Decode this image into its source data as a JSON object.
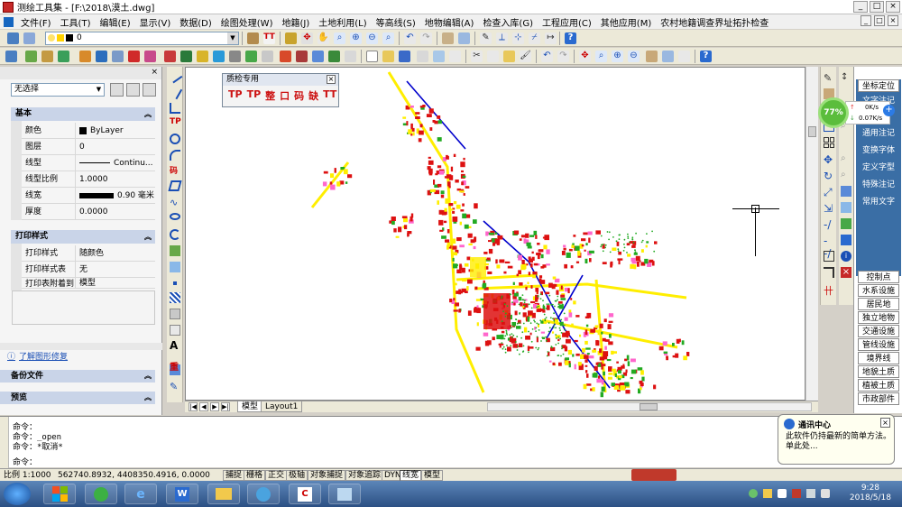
{
  "window": {
    "title": "测绘工具集 - [F:\\2018\\漠土.dwg]",
    "buttons": [
      "_",
      "□",
      "×"
    ]
  },
  "menu": {
    "items": [
      "文件(F)",
      "工具(T)",
      "编辑(E)",
      "显示(V)",
      "数据(D)",
      "绘图处理(W)",
      "地籍(J)",
      "土地利用(L)",
      "等高线(S)",
      "地物编辑(A)",
      "检查入库(G)",
      "工程应用(C)",
      "其他应用(M)",
      "农村地籍调查界址拓扑检查"
    ],
    "mdi_buttons": [
      "_",
      "□",
      "×"
    ]
  },
  "toolbar": {
    "layer_value": "0"
  },
  "properties": {
    "selection": "无选择",
    "basic_title": "基本",
    "basic": [
      {
        "key": "颜色",
        "value": "ByLayer"
      },
      {
        "key": "图层",
        "value": "0"
      },
      {
        "key": "线型",
        "value": "Continu..."
      },
      {
        "key": "线型比例",
        "value": "1.0000"
      },
      {
        "key": "线宽",
        "value": "0.90 毫米"
      },
      {
        "key": "厚度",
        "value": "0.0000"
      }
    ],
    "print_title": "打印样式",
    "print": [
      {
        "key": "打印样式",
        "value": "随颜色"
      },
      {
        "key": "打印样式表",
        "value": "无"
      },
      {
        "key": "打印表附着到",
        "value": "模型"
      }
    ]
  },
  "lower_panel": {
    "link": "了解图形修复",
    "backup": "备份文件",
    "preview": "预览"
  },
  "float_toolbar": {
    "title": "质检专用",
    "icons": [
      "TP",
      "TP",
      "整",
      "口",
      "码",
      "缺",
      "TT"
    ]
  },
  "right_panel": {
    "top_buttons": [
      "坐标定位",
      "文字注记",
      "通用注记",
      "变换字体",
      "定义字型",
      "特殊注记",
      "常用文字"
    ],
    "bottom_buttons": [
      "控制点",
      "水系设施",
      "居民地",
      "独立地物",
      "交通设施",
      "管线设施",
      "境界线",
      "地貌土质",
      "植被土质",
      "市政部件"
    ]
  },
  "speed_widget": {
    "percent": "77%",
    "up": "0K/s",
    "down": "0.07K/s"
  },
  "layout_tabs": [
    "模型",
    "Layout1"
  ],
  "command": {
    "lines": [
      "命令：",
      "命令：_open",
      "命令：*取消*",
      "命令："
    ]
  },
  "balloon": {
    "title": "通讯中心",
    "text": "此软件仍持最新的简单方法。单此处..."
  },
  "status": {
    "scale": "比例 1:1000",
    "coords": "562740.8932, 4408350.4916, 0.0000",
    "toggles": [
      "捕捉",
      "栅格",
      "正交",
      "极轴",
      "对象捕捉",
      "对象追踪",
      "DYN",
      "线宽",
      "模型"
    ]
  },
  "clock": {
    "time": "9:28",
    "date": "2018/5/18"
  },
  "colors": {
    "map_red": "#dd1111",
    "map_yellow": "#ffee00",
    "map_blue": "#0000cc",
    "map_green": "#22aa22",
    "panel_blue": "#3a6ea5"
  }
}
